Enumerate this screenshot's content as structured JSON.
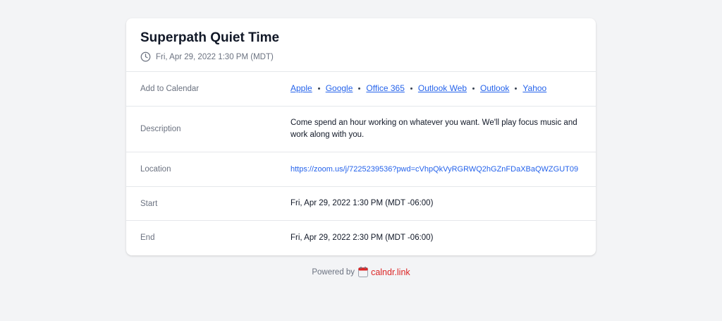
{
  "event": {
    "title": "Superpath Quiet Time",
    "datetime_short": "Fri, Apr 29, 2022 1:30 PM (MDT)"
  },
  "rows": {
    "calendar": {
      "label": "Add to Calendar",
      "links": [
        "Apple",
        "Google",
        "Office 365",
        "Outlook Web",
        "Outlook",
        "Yahoo"
      ]
    },
    "description": {
      "label": "Description",
      "value": "Come spend an hour working on whatever you want. We'll play focus music and work along with you."
    },
    "location": {
      "label": "Location",
      "value": "https://zoom.us/j/7225239536?pwd=cVhpQkVyRGRWQ2hGZnFDaXBaQWZGUT09"
    },
    "start": {
      "label": "Start",
      "value": "Fri, Apr 29, 2022 1:30 PM (MDT -06:00)"
    },
    "end": {
      "label": "End",
      "value": "Fri, Apr 29, 2022 2:30 PM (MDT -06:00)"
    }
  },
  "footer": {
    "powered_by": "Powered by",
    "brand": "calndr.link"
  },
  "icons": {
    "clock": "clock-icon",
    "calendar": "calendar-icon"
  },
  "colors": {
    "link": "#2563eb",
    "brand": "#dc2626",
    "background": "#f3f4f6"
  }
}
